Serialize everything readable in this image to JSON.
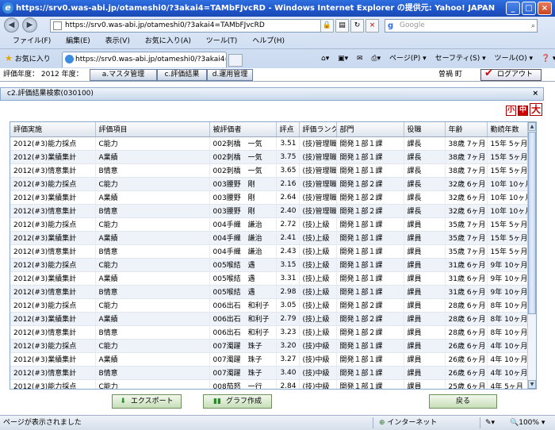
{
  "window": {
    "title": "https://srv0.was-abi.jp/otameshi0/?3akai4=TAMbFJvcRD - Windows Internet Explorer の提供元: Yahoo! JAPAN"
  },
  "browser": {
    "address": "https://srv0.was-abi.jp/otameshi0/?3akai4=TAMbFJvcRD",
    "search_placeholder": "Google",
    "menu": [
      "ファイル(F)",
      "編集(E)",
      "表示(V)",
      "お気に入り(A)",
      "ツール(T)",
      "ヘルプ(H)"
    ],
    "favorites": "お気に入り",
    "tab_title": "https://srv0.was-abi.jp/otameshi0/?3akai4=TAMbF...",
    "commands": [
      "ページ(P) ▾",
      "セーフティ(S) ▾",
      "ツール(O) ▾",
      "❓ ▾"
    ]
  },
  "appbar": {
    "year_label": "評価年度： 2012  年度：",
    "menu_buttons": [
      "a.マスタ管理",
      "c.評価結果",
      "d.運用管理"
    ],
    "user_label": "曽禍  町",
    "logout": "ログアウト"
  },
  "panel": {
    "title": "c2.評価結果検索(030100)",
    "close": "×",
    "font_sizes": [
      "小",
      "中",
      "大"
    ]
  },
  "grid": {
    "headers": [
      "評価実施",
      "評価項目",
      "被評価者",
      "評点",
      "評価ランク",
      "部門",
      "役職",
      "年齢",
      "勤続年数"
    ],
    "rows": [
      [
        "2012(#3)能力採点",
        "C能力",
        "002刺橋　一気",
        "3.51",
        "(技)管理職",
        "開発１部１課",
        "課長",
        "38歳 7ヶ月",
        "15年 5ヶ月"
      ],
      [
        "2012(#3)業績集計",
        "A業績",
        "002刺橋　一気",
        "3.75",
        "(技)管理職",
        "開発１部１課",
        "課長",
        "38歳 7ヶ月",
        "15年 5ヶ月"
      ],
      [
        "2012(#3)情意集計",
        "B情意",
        "002刺橋　一気",
        "3.65",
        "(技)管理職",
        "開発１部１課",
        "課長",
        "38歳 7ヶ月",
        "15年 5ヶ月"
      ],
      [
        "2012(#3)能力採点",
        "C能力",
        "003腰野　剛",
        "2.16",
        "(技)管理職",
        "開発１部２課",
        "課長",
        "32歳 6ヶ月",
        "10年 10ヶ月"
      ],
      [
        "2012(#3)業績集計",
        "A業績",
        "003腰野　剛",
        "2.64",
        "(技)管理職",
        "開発１部２課",
        "課長",
        "32歳 6ヶ月",
        "10年 10ヶ月"
      ],
      [
        "2012(#3)情意集計",
        "B情意",
        "003腰野　剛",
        "2.40",
        "(技)管理職",
        "開発１部２課",
        "課長",
        "32歳 6ヶ月",
        "10年 10ヶ月"
      ],
      [
        "2012(#3)能力採点",
        "C能力",
        "004手織　謙治",
        "2.72",
        "(技)上級",
        "開発１部１課",
        "課員",
        "35歳 7ヶ月",
        "15年 5ヶ月"
      ],
      [
        "2012(#3)業績集計",
        "A業績",
        "004手織　謙治",
        "2.41",
        "(技)上級",
        "開発１部１課",
        "課員",
        "35歳 7ヶ月",
        "15年 5ヶ月"
      ],
      [
        "2012(#3)情意集計",
        "B情意",
        "004手織　謙治",
        "2.43",
        "(技)上級",
        "開発１部１課",
        "課員",
        "35歳 7ヶ月",
        "15年 5ヶ月"
      ],
      [
        "2012(#3)能力採点",
        "C能力",
        "005喉結　遇",
        "3.15",
        "(技)上級",
        "開発１部１課",
        "課員",
        "31歳 6ヶ月",
        "9年 10ヶ月"
      ],
      [
        "2012(#3)業績集計",
        "A業績",
        "005喉結　遇",
        "3.31",
        "(技)上級",
        "開発１部１課",
        "課員",
        "31歳 6ヶ月",
        "9年 10ヶ月"
      ],
      [
        "2012(#3)情意集計",
        "B情意",
        "005喉結　遇",
        "2.98",
        "(技)上級",
        "開発１部１課",
        "課員",
        "31歳 6ヶ月",
        "9年 10ヶ月"
      ],
      [
        "2012(#3)能力採点",
        "C能力",
        "006出石　和利子",
        "3.05",
        "(技)上級",
        "開発１部２課",
        "課員",
        "28歳 6ヶ月",
        "8年 10ヶ月"
      ],
      [
        "2012(#3)業績集計",
        "A業績",
        "006出石　和利子",
        "2.79",
        "(技)上級",
        "開発１部２課",
        "課員",
        "28歳 6ヶ月",
        "8年 10ヶ月"
      ],
      [
        "2012(#3)情意集計",
        "B情意",
        "006出石　和利子",
        "3.23",
        "(技)上級",
        "開発１部２課",
        "課員",
        "28歳 6ヶ月",
        "8年 10ヶ月"
      ],
      [
        "2012(#3)能力採点",
        "C能力",
        "007濁躍　珠子",
        "3.20",
        "(技)中級",
        "開発１部１課",
        "課員",
        "26歳 6ヶ月",
        "4年 10ヶ月"
      ],
      [
        "2012(#3)業績集計",
        "A業績",
        "007濁躍　珠子",
        "3.27",
        "(技)中級",
        "開発１部１課",
        "課員",
        "26歳 6ヶ月",
        "4年 10ヶ月"
      ],
      [
        "2012(#3)情意集計",
        "B情意",
        "007濁躍　珠子",
        "3.40",
        "(技)中級",
        "開発１部１課",
        "課員",
        "26歳 6ヶ月",
        "4年 10ヶ月"
      ],
      [
        "2012(#3)能力採点",
        "C能力",
        "008茄怒　一行",
        "2.84",
        "(技)中級",
        "開発１部１課",
        "課員",
        "25歳 6ヶ月",
        "4年 5ヶ月"
      ]
    ]
  },
  "buttons": {
    "export": "エクスポート",
    "graph": "グラフ作成",
    "back": "戻る"
  },
  "status": {
    "text": "ページが表示されました",
    "zone": "インターネット",
    "zoom": "100%"
  }
}
